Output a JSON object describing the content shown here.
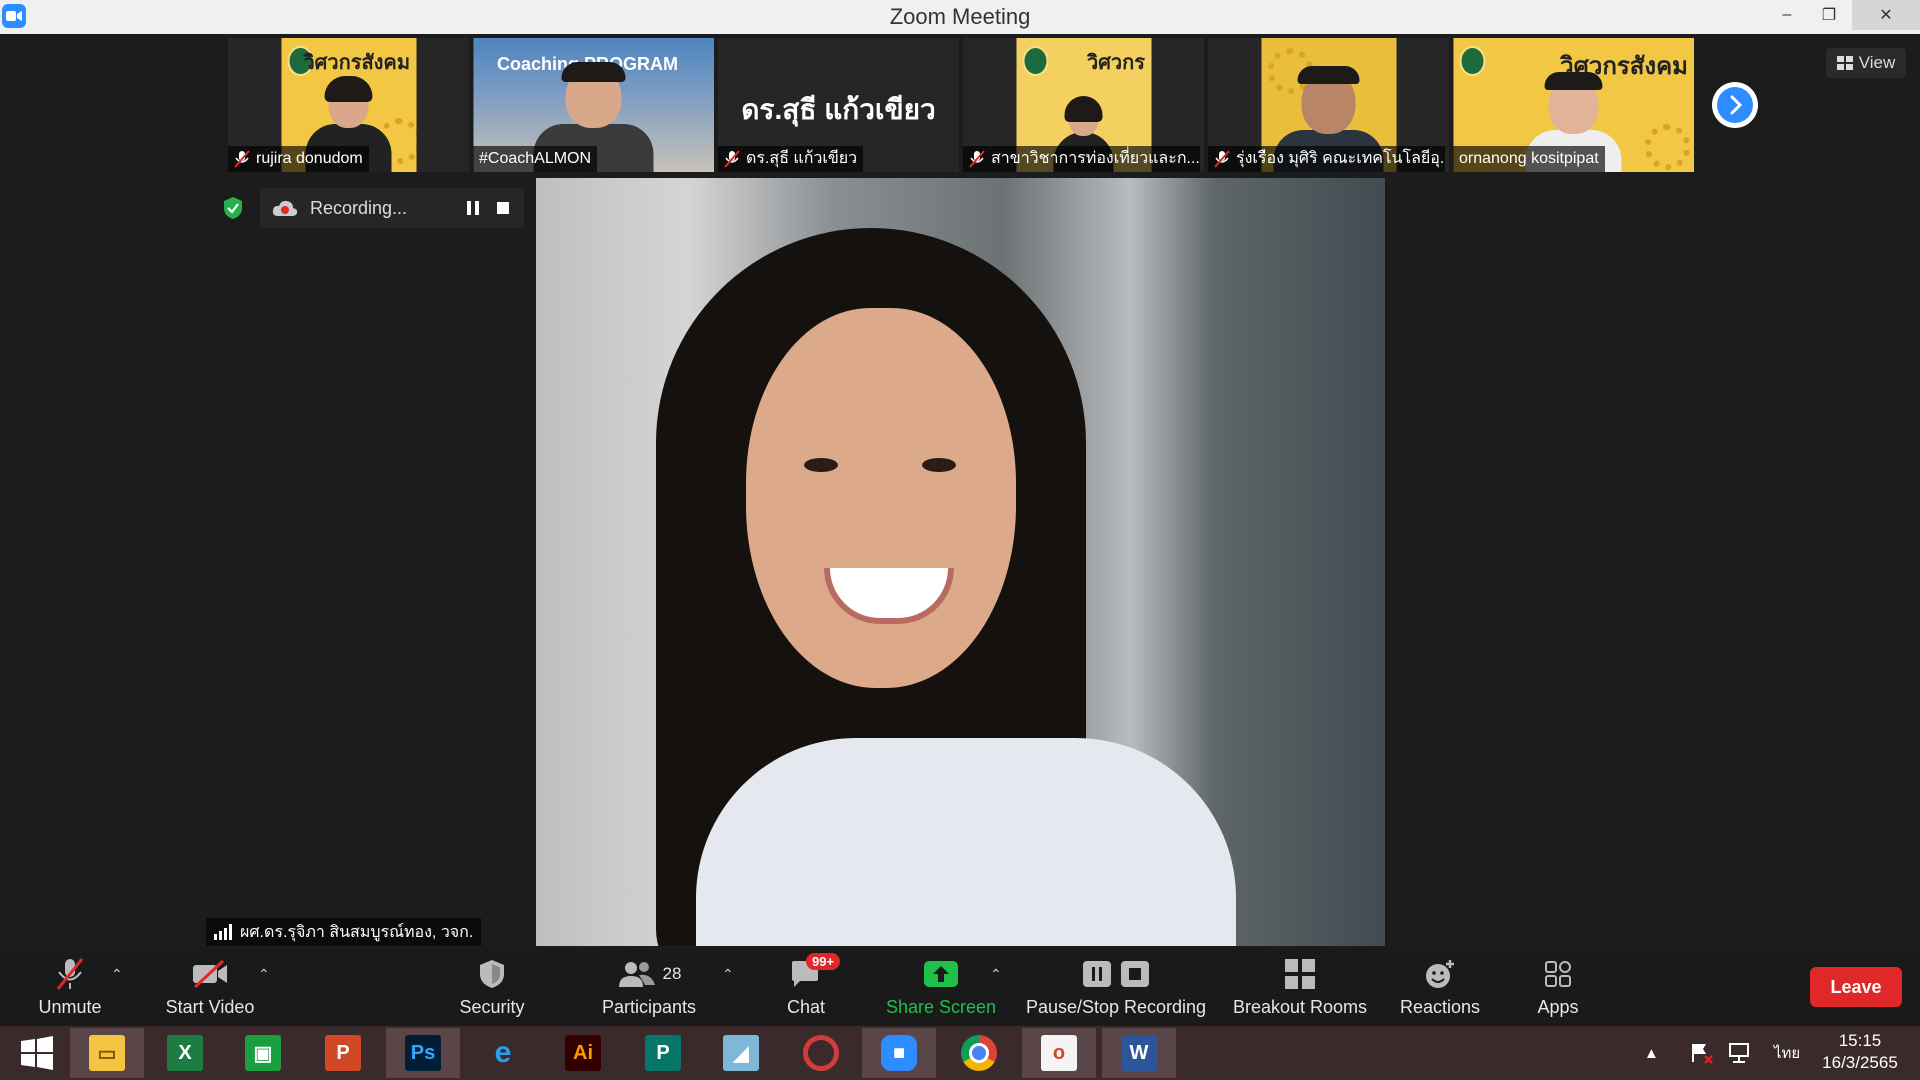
{
  "window": {
    "title": "Zoom Meeting",
    "minimize": "–",
    "restore": "❐",
    "close": "✕"
  },
  "top_strip": {
    "participants": [
      {
        "name": "rujira donudom",
        "muted": true,
        "thumb": "poster",
        "poster_title": "วิศวกรสังคม"
      },
      {
        "name": "#CoachALMON",
        "muted": false,
        "thumb": "classroom",
        "poster_title": "Coaching PROGRAM"
      },
      {
        "name": "ดร.สุธี  แก้วเขียว",
        "muted": true,
        "thumb": "text",
        "display_text": "ดร.สุธี  แก้วเขียว"
      },
      {
        "name": "สาขาวิชาการท่องเที่ยวและก...",
        "muted": true,
        "thumb": "poster",
        "poster_title": "วิศวกร"
      },
      {
        "name": "รุ่งเรือง มุศิริ คณะเทคโนโลยีอุ...",
        "muted": true,
        "thumb": "poster",
        "poster_title": ""
      },
      {
        "name": "ornanong kositpipat",
        "muted": false,
        "thumb": "poster",
        "poster_title": "วิศวกรสังคม"
      }
    ],
    "view_label": "View"
  },
  "recording": {
    "label": "Recording..."
  },
  "active_speaker": {
    "name": "ผศ.ดร.รุจิภา สินสมบูรณ์ทอง, วจก."
  },
  "toolbar": {
    "unmute": "Unmute",
    "start_video": "Start Video",
    "security": "Security",
    "participants": "Participants",
    "participants_count": "28",
    "chat": "Chat",
    "chat_badge": "99+",
    "share_screen": "Share Screen",
    "pause_stop_recording": "Pause/Stop Recording",
    "breakout_rooms": "Breakout Rooms",
    "reactions": "Reactions",
    "apps": "Apps",
    "leave": "Leave"
  },
  "taskbar": {
    "language": "ไทย",
    "time": "15:15",
    "date": "16/3/2565",
    "apps": [
      "File Explorer",
      "Excel",
      "Store",
      "PowerPoint",
      "Photoshop",
      "Internet Explorer",
      "Illustrator",
      "Publisher",
      "Notes",
      "Photoscape",
      "Zoom",
      "Chrome",
      "Office",
      "Word"
    ]
  },
  "colors": {
    "accent_blue": "#2d8cff",
    "leave_red": "#e02828",
    "share_green": "#1ec04a",
    "secure_green": "#23b14d"
  }
}
